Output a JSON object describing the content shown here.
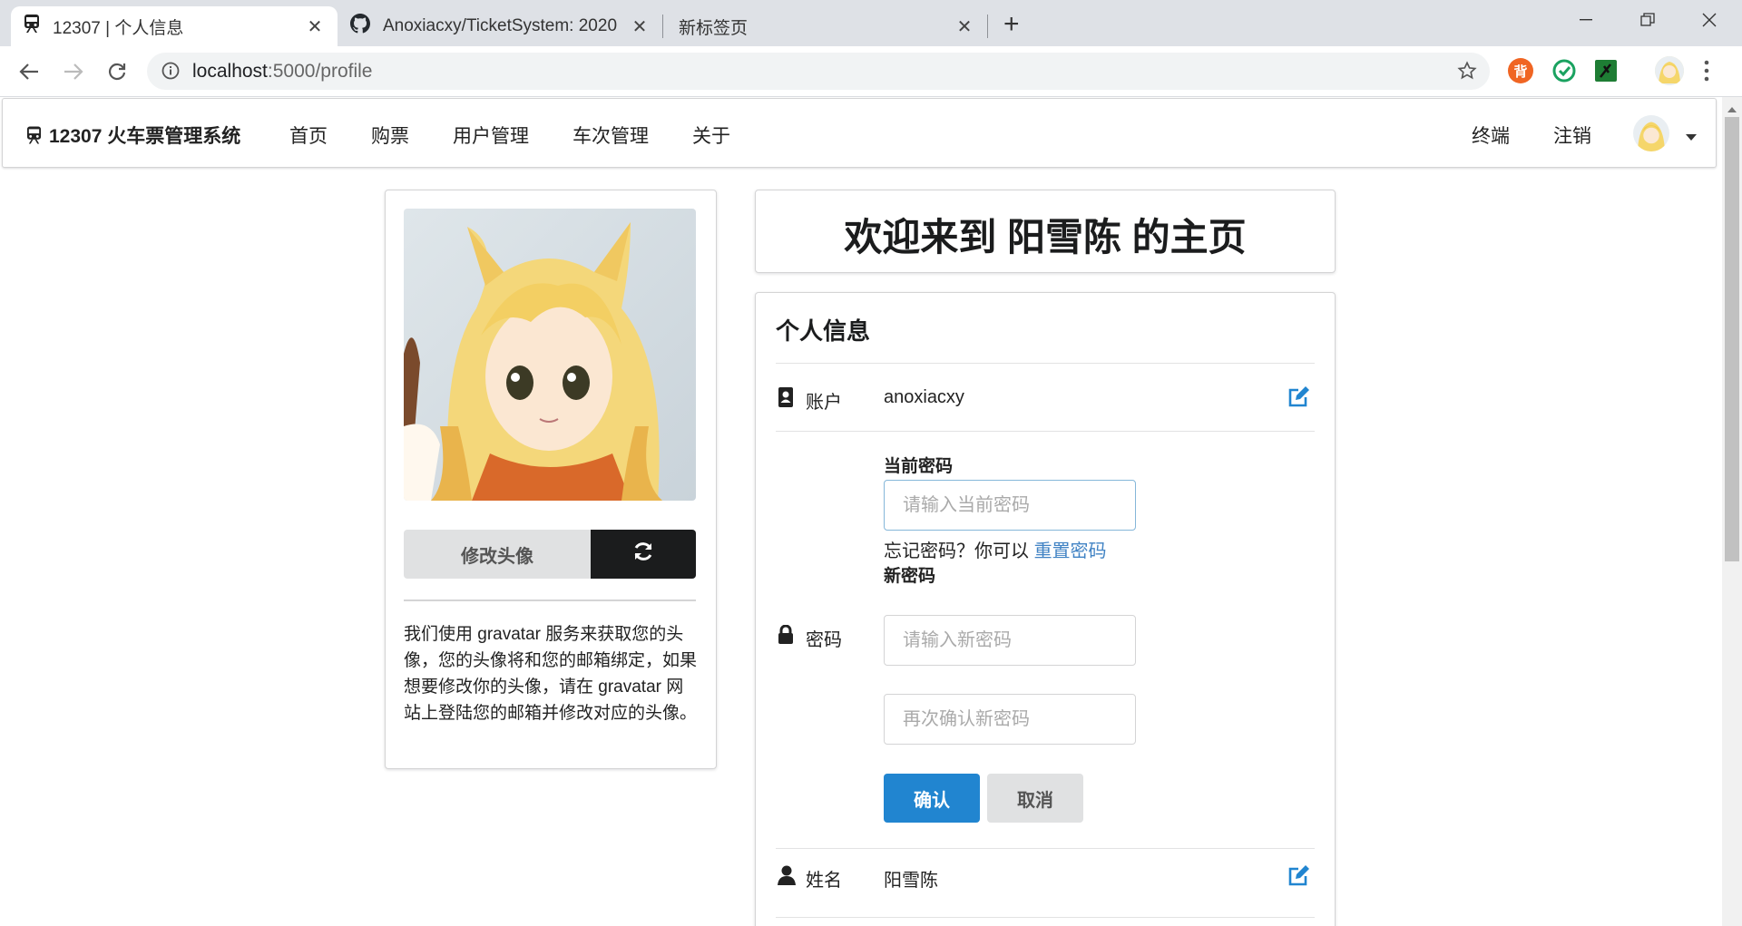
{
  "browser": {
    "tabs": [
      {
        "title": "12307 | 个人信息",
        "active": true
      },
      {
        "title": "Anoxiacxy/TicketSystem: 2020",
        "active": false
      },
      {
        "title": "新标签页",
        "active": false
      }
    ],
    "url_host": "localhost",
    "url_path": ":5000/profile",
    "extensions": [
      {
        "icon": "bei-extension-icon",
        "label": "背",
        "color": "#f06523"
      },
      {
        "icon": "sync-extension-icon",
        "label": "",
        "color": "#1aa260"
      },
      {
        "icon": "terminal-extension-icon",
        "label": "",
        "color": "#1e7d34"
      }
    ]
  },
  "navbar": {
    "brand": "12307 火车票管理系统",
    "items": [
      "首页",
      "购票",
      "用户管理",
      "车次管理",
      "关于"
    ],
    "right_items": [
      "终端",
      "注销"
    ]
  },
  "avatar_card": {
    "change_avatar_label": "修改头像",
    "description": "我们使用 gravatar 服务来获取您的头像，您的头像将和您的邮箱绑定，如果想要修改你的头像，请在 gravatar 网站上登陆您的邮箱并修改对应的头像。"
  },
  "welcome": {
    "title": "欢迎来到 阳雪陈 的主页"
  },
  "profile": {
    "header": "个人信息",
    "account": {
      "label": "账户",
      "value": "anoxiacxy"
    },
    "password": {
      "label": "密码",
      "current_label": "当前密码",
      "current_placeholder": "请输入当前密码",
      "forgot_text": "忘记密码？你可以",
      "reset_link": "重置密码",
      "new_label": "新密码",
      "new_placeholder": "请输入新密码",
      "confirm_placeholder": "再次确认新密码",
      "confirm_button": "确认",
      "cancel_button": "取消"
    },
    "name": {
      "label": "姓名",
      "value": "阳雪陈"
    }
  },
  "colors": {
    "primary": "#2185d0",
    "link": "#4183c4",
    "dark_button": "#1b1c1d",
    "grey_button": "#e0e1e2"
  }
}
